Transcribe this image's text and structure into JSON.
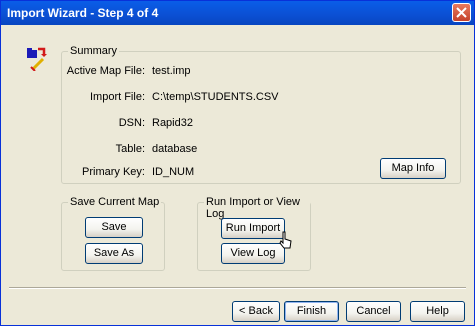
{
  "window": {
    "title": "Import Wizard - Step 4 of 4"
  },
  "icons": {
    "wizard": "import-wizard-icon",
    "close": "close-icon",
    "cursor": "mouse-pointer-icon"
  },
  "summary": {
    "label": "Summary",
    "fields": [
      {
        "label": "Active Map File:",
        "value": "test.imp"
      },
      {
        "label": "Import File:",
        "value": "C:\\temp\\STUDENTS.CSV"
      },
      {
        "label": "DSN:",
        "value": "Rapid32"
      },
      {
        "label": "Table:",
        "value": "database"
      },
      {
        "label": "Primary Key:",
        "value": "ID_NUM"
      }
    ],
    "map_info_label": "Map Info"
  },
  "save_map": {
    "label": "Save Current Map",
    "save_label": "Save",
    "save_as_label": "Save As"
  },
  "run": {
    "label": "Run Import or View Log",
    "run_import_label": "Run Import",
    "view_log_label": "View Log"
  },
  "footer": {
    "back_label": "< Back",
    "finish_label": "Finish",
    "cancel_label": "Cancel",
    "help_label": "Help"
  }
}
